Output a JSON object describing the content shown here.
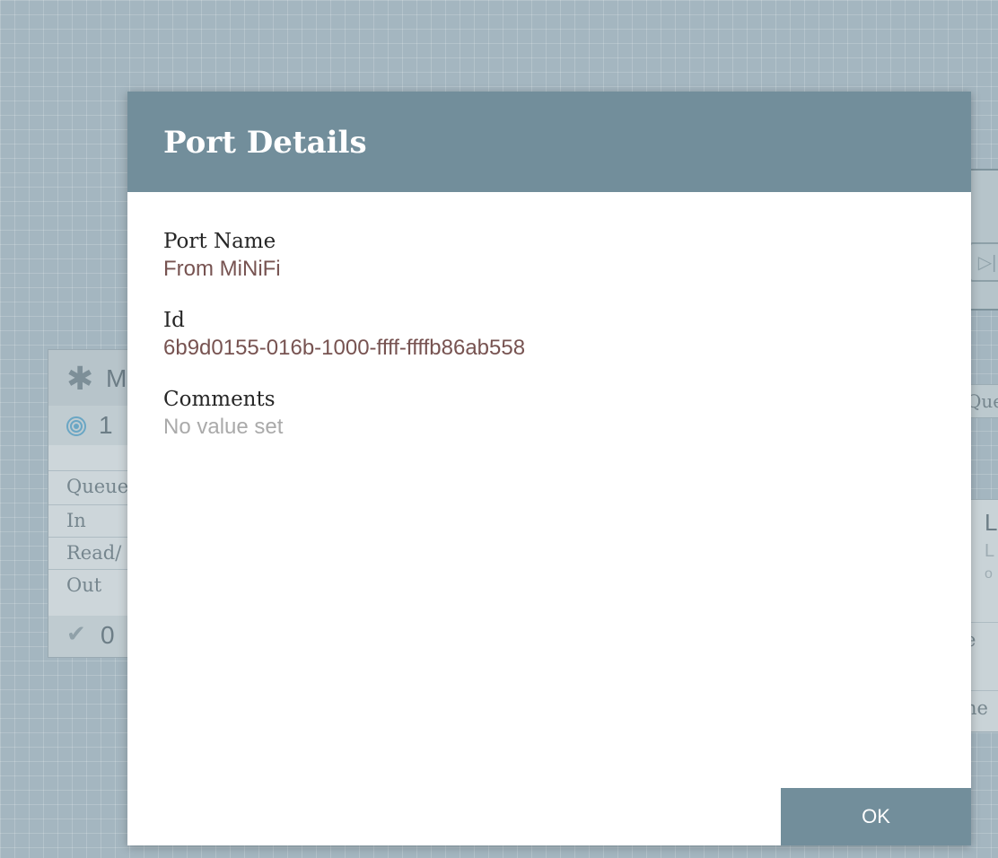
{
  "background": {
    "processor": {
      "name_fragment": "M",
      "count": "1",
      "rows": [
        "Queue",
        "In",
        "Read/",
        "Out"
      ],
      "footer_count": "0"
    },
    "right_fragments": {
      "button_glyph": "▷|",
      "queue_fragment": "Que",
      "title_fragment": "L",
      "subtitle_fragment": "L",
      "small_fragment": "o",
      "row_fragments": [
        "e",
        "ne"
      ]
    }
  },
  "dialog": {
    "title": "Port Details",
    "fields": [
      {
        "label": "Port Name",
        "value": "From MiNiFi"
      },
      {
        "label": "Id",
        "value": "6b9d0155-016b-1000-ffff-ffffb86ab558"
      },
      {
        "label": "Comments",
        "value": "No value set"
      }
    ],
    "ok_label": "OK"
  },
  "colors": {
    "header": "#728e9b",
    "value_text": "#775351",
    "unset_text": "#aaaaaa",
    "canvas": "#a4b6c0"
  }
}
